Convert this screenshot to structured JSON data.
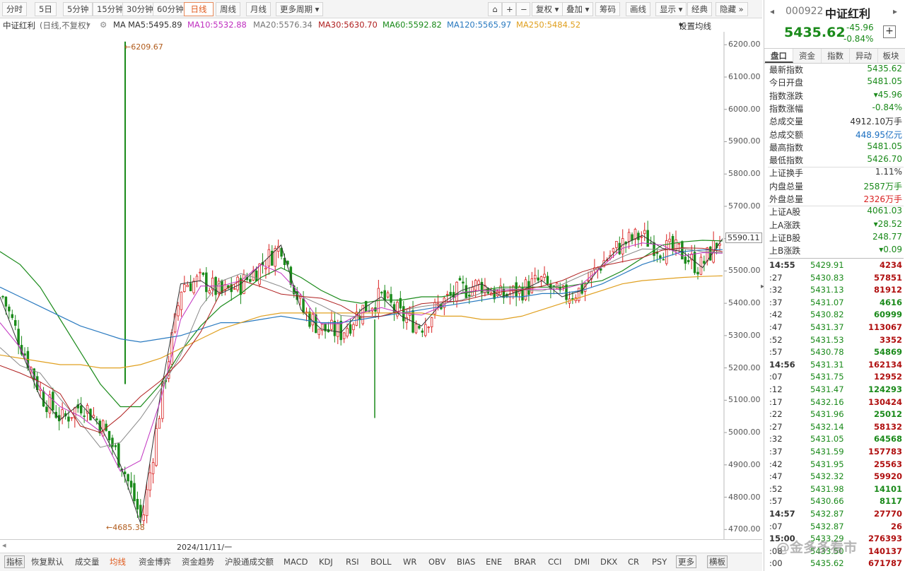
{
  "toolbar": {
    "items": [
      "分时",
      "5日",
      "5分钟",
      "15分钟",
      "30分钟",
      "60分钟",
      "日线",
      "周线",
      "月线",
      "更多周期"
    ],
    "right_items": [
      "复权",
      "叠加",
      "筹码",
      "画线",
      "显示",
      "经典",
      "隐藏"
    ]
  },
  "legend": {
    "name": "中证红利",
    "mode": "(日线,不复权)",
    "ma_label": "MA",
    "ma5": "MA5:5495.89",
    "ma10": "MA10:5532.88",
    "ma20": "MA20:5576.34",
    "ma30": "MA30:5630.70",
    "ma60": "MA60:5592.82",
    "ma120": "MA120:5565.97",
    "ma250": "MA250:5484.52",
    "settings": "设置均线",
    "colors": {
      "ma5": "#333333",
      "ma10": "#c030c0",
      "ma20": "#888888",
      "ma30": "#b02020",
      "ma60": "#1a8a1a",
      "ma120": "#2a7ac0",
      "ma250": "#e0a020"
    }
  },
  "chart": {
    "high_label": "6209.67",
    "low_label": "4685.38",
    "current_label": "5590.11",
    "date_label": "2024/11/11/一"
  },
  "chart_data": {
    "type": "line",
    "title": "",
    "y_ticks": [
      6200,
      6100,
      6000,
      5900,
      5800,
      5700,
      5600,
      5500,
      5400,
      5300,
      5200,
      5100,
      5000,
      4900,
      4800,
      4700
    ],
    "ylim": [
      4670,
      6240
    ],
    "x": [
      0,
      5,
      10,
      15,
      20,
      25,
      30,
      35,
      40,
      45,
      50,
      55,
      60,
      65,
      70,
      75,
      80,
      85,
      90,
      95,
      100,
      105,
      110,
      115,
      120,
      125,
      130,
      135,
      140,
      145,
      150,
      155,
      160,
      165,
      170,
      175,
      180
    ],
    "series": [
      {
        "name": "close",
        "values": [
          5420,
          5260,
          5110,
          5040,
          5090,
          5020,
          4900,
          4720,
          5120,
          5460,
          5470,
          5430,
          5460,
          5520,
          5580,
          5380,
          5320,
          5310,
          5380,
          5420,
          5360,
          5330,
          5400,
          5440,
          5460,
          5420,
          5440,
          5470,
          5420,
          5440,
          5520,
          5580,
          5610,
          5570,
          5560,
          5510,
          5600
        ]
      },
      {
        "name": "ma60",
        "values": [
          5560,
          5520,
          5450,
          5350,
          5250,
          5150,
          5080,
          5080,
          5150,
          5250,
          5330,
          5390,
          5430,
          5480,
          5510,
          5480,
          5440,
          5410,
          5400,
          5410,
          5410,
          5420,
          5420,
          5430,
          5440,
          5450,
          5450,
          5450,
          5450,
          5460,
          5470,
          5500,
          5540,
          5580,
          5590,
          5595,
          5593
        ]
      },
      {
        "name": "ma120",
        "values": [
          5450,
          5420,
          5390,
          5360,
          5330,
          5310,
          5290,
          5280,
          5290,
          5300,
          5320,
          5340,
          5340,
          5350,
          5360,
          5350,
          5340,
          5340,
          5350,
          5360,
          5370,
          5380,
          5390,
          5400,
          5410,
          5420,
          5420,
          5430,
          5430,
          5440,
          5460,
          5490,
          5520,
          5540,
          5560,
          5565,
          5566
        ]
      },
      {
        "name": "ma250",
        "values": [
          5240,
          5230,
          5220,
          5210,
          5210,
          5200,
          5200,
          5210,
          5230,
          5260,
          5290,
          5320,
          5340,
          5360,
          5370,
          5370,
          5370,
          5370,
          5370,
          5370,
          5370,
          5370,
          5360,
          5360,
          5350,
          5350,
          5360,
          5380,
          5400,
          5420,
          5440,
          5460,
          5470,
          5475,
          5480,
          5483,
          5485
        ]
      }
    ]
  },
  "right": {
    "code": "000922",
    "name": "中证红利",
    "price": "5435.62",
    "change": "-45.96",
    "change_pct": "-0.84%",
    "tabs": [
      "盘口",
      "资金",
      "指数",
      "异动",
      "板块"
    ],
    "quote": [
      {
        "label": "最新指数",
        "value": "5435.62",
        "cls": "g"
      },
      {
        "label": "今日开盘",
        "value": "5481.05",
        "cls": "g"
      },
      {
        "label": "指数涨跌",
        "value": "▾45.96",
        "cls": "g"
      },
      {
        "label": "指数涨幅",
        "value": "-0.84%",
        "cls": "g"
      },
      {
        "label": "总成交量",
        "value": "4912.10万手",
        "cls": ""
      },
      {
        "label": "总成交额",
        "value": "448.95亿元",
        "cls": "b"
      },
      {
        "label": "最高指数",
        "value": "5481.05",
        "cls": "g"
      },
      {
        "label": "最低指数",
        "value": "5426.70",
        "cls": "g"
      },
      {
        "label": "上证换手",
        "value": "1.11%",
        "cls": ""
      },
      {
        "label": "内盘总量",
        "value": "2587万手",
        "cls": "g"
      },
      {
        "label": "外盘总量",
        "value": "2326万手",
        "cls": "r"
      },
      {
        "label": "上证A股",
        "value": "4061.03",
        "cls": "g"
      },
      {
        "label": "上A涨跌",
        "value": "▾28.52",
        "cls": "g"
      },
      {
        "label": "上证B股",
        "value": "248.77",
        "cls": "g"
      },
      {
        "label": "上B涨跌",
        "value": "▾0.09",
        "cls": "g"
      }
    ],
    "ticks": [
      {
        "t": "14:55",
        "p": "5429.91",
        "q": "4234",
        "c": "r"
      },
      {
        "t": ":27",
        "p": "5430.83",
        "q": "57851",
        "c": "r"
      },
      {
        "t": ":32",
        "p": "5431.13",
        "q": "81912",
        "c": "r"
      },
      {
        "t": ":37",
        "p": "5431.07",
        "q": "4616",
        "c": "g"
      },
      {
        "t": ":42",
        "p": "5430.82",
        "q": "60999",
        "c": "g"
      },
      {
        "t": ":47",
        "p": "5431.37",
        "q": "113067",
        "c": "r"
      },
      {
        "t": ":52",
        "p": "5431.53",
        "q": "3352",
        "c": "r"
      },
      {
        "t": ":57",
        "p": "5430.78",
        "q": "54869",
        "c": "g"
      },
      {
        "t": "14:56",
        "p": "5431.31",
        "q": "162134",
        "c": "r"
      },
      {
        "t": ":07",
        "p": "5431.75",
        "q": "12952",
        "c": "r"
      },
      {
        "t": ":12",
        "p": "5431.47",
        "q": "124293",
        "c": "g"
      },
      {
        "t": ":17",
        "p": "5432.16",
        "q": "130424",
        "c": "r"
      },
      {
        "t": ":22",
        "p": "5431.96",
        "q": "25012",
        "c": "g"
      },
      {
        "t": ":27",
        "p": "5432.14",
        "q": "58132",
        "c": "r"
      },
      {
        "t": ":32",
        "p": "5431.05",
        "q": "64568",
        "c": "g"
      },
      {
        "t": ":37",
        "p": "5431.59",
        "q": "157783",
        "c": "r"
      },
      {
        "t": ":42",
        "p": "5431.95",
        "q": "25563",
        "c": "r"
      },
      {
        "t": ":47",
        "p": "5432.32",
        "q": "59920",
        "c": "r"
      },
      {
        "t": ":52",
        "p": "5431.98",
        "q": "14101",
        "c": "g"
      },
      {
        "t": ":57",
        "p": "5430.66",
        "q": "8117",
        "c": "g"
      },
      {
        "t": "14:57",
        "p": "5432.87",
        "q": "27770",
        "c": "r"
      },
      {
        "t": ":07",
        "p": "5432.87",
        "q": "26",
        "c": "r"
      },
      {
        "t": "15:00",
        "p": "5433.29",
        "q": "276393",
        "c": "r"
      },
      {
        "t": ":08",
        "p": "5433.50",
        "q": "140137",
        "c": "r"
      },
      {
        "t": ":00",
        "p": "5435.62",
        "q": "671787",
        "c": "r"
      }
    ]
  },
  "bottom": {
    "items": [
      "指标",
      "恢复默认",
      "成交量",
      "均线",
      "资金博弈",
      "资金趋势",
      "沪股通成交额",
      "MACD",
      "KDJ",
      "RSI",
      "BOLL",
      "WR",
      "OBV",
      "BIAS",
      "ENE",
      "BRAR",
      "CCI",
      "DMI",
      "DKX",
      "CR",
      "PSY",
      "更多",
      "横板"
    ]
  },
  "watermark": "@金多多看市"
}
